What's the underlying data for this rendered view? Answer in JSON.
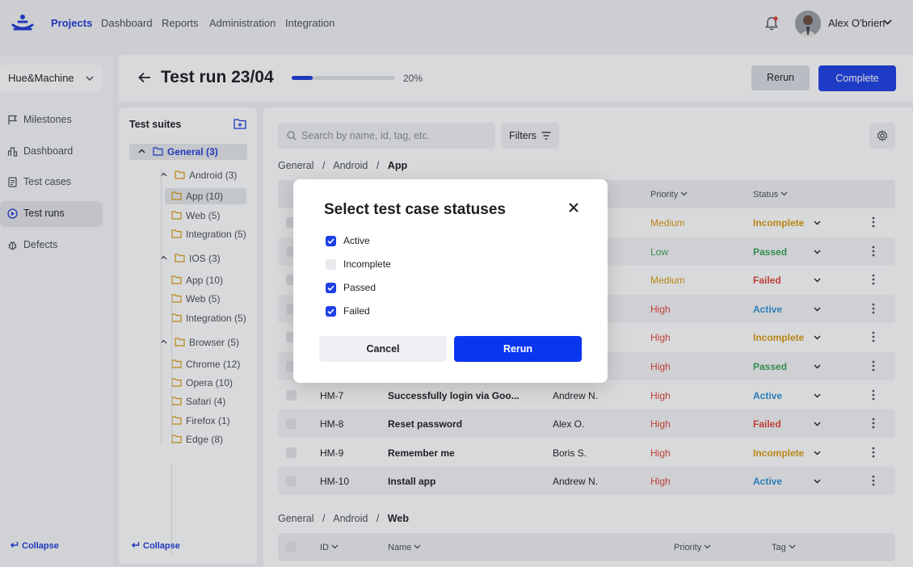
{
  "nav": {
    "links": [
      "Projects",
      "Dashboard",
      "Reports",
      "Administration",
      "Integration"
    ],
    "active": "Projects",
    "user_name": "Alex O'brien"
  },
  "sidebar": {
    "project": "Hue&Machine",
    "items": [
      {
        "label": "Milestones",
        "icon": "flag-icon"
      },
      {
        "label": "Dashboard",
        "icon": "bar-chart-icon"
      },
      {
        "label": "Test cases",
        "icon": "document-icon"
      },
      {
        "label": "Test runs",
        "icon": "play-circle-icon",
        "active": true
      },
      {
        "label": "Defects",
        "icon": "bug-icon"
      }
    ],
    "collapse_label": "Collapse"
  },
  "header": {
    "title": "Test run 23/04",
    "progress": 0.2,
    "progress_text": "20%",
    "rerun_label": "Rerun",
    "complete_label": "Complete"
  },
  "suites": {
    "title": "Test suites",
    "collapse_label": "Collapse",
    "tree": [
      {
        "label": "General (3)",
        "level": 0,
        "expanded": true,
        "selected": true
      },
      {
        "label": "Android (3)",
        "level": 1,
        "expanded": true
      },
      {
        "label": "App (10)",
        "level": 2,
        "selected": true
      },
      {
        "label": "Web (5)",
        "level": 2
      },
      {
        "label": "Integration (5)",
        "level": 2
      },
      {
        "label": "IOS (3)",
        "level": 1,
        "expanded": true
      },
      {
        "label": "App (10)",
        "level": 2
      },
      {
        "label": "Web (5)",
        "level": 2
      },
      {
        "label": "Integration (5)",
        "level": 2
      },
      {
        "label": "Browser (5)",
        "level": 1,
        "expanded": true
      },
      {
        "label": "Chrome (12)",
        "level": 2
      },
      {
        "label": "Opera (10)",
        "level": 2
      },
      {
        "label": "Safari (4)",
        "level": 2
      },
      {
        "label": "Firefox (1)",
        "level": 2
      },
      {
        "label": "Edge (8)",
        "level": 2
      }
    ]
  },
  "toolbar": {
    "search_placeholder": "Search by name, id, tag, etc.",
    "filters_label": "Filters"
  },
  "table1": {
    "breadcrumb": [
      "General",
      "Android",
      "App"
    ],
    "headers": {
      "priority": "Priority",
      "status": "Status"
    },
    "rows": [
      {
        "id": "",
        "name": "",
        "author": "",
        "priority": "Medium",
        "status": "Incomplete"
      },
      {
        "id": "",
        "name": "",
        "author": "",
        "priority": "Low",
        "status": "Passed"
      },
      {
        "id": "",
        "name": "",
        "author": "",
        "priority": "Medium",
        "status": "Failed"
      },
      {
        "id": "",
        "name": "",
        "author": "",
        "priority": "High",
        "status": "Active"
      },
      {
        "id": "",
        "name": "",
        "author": "",
        "priority": "High",
        "status": "Incomplete"
      },
      {
        "id": "",
        "name": "",
        "author": "",
        "priority": "High",
        "status": "Passed"
      },
      {
        "id": "HM-7",
        "name": "Successfully login via Goo...",
        "author": "Andrew N.",
        "priority": "High",
        "status": "Active"
      },
      {
        "id": "HM-8",
        "name": "Reset password",
        "author": "Alex O.",
        "priority": "High",
        "status": "Failed"
      },
      {
        "id": "HM-9",
        "name": "Remember me",
        "author": "Boris S.",
        "priority": "High",
        "status": "Incomplete"
      },
      {
        "id": "HM-10",
        "name": "Install app",
        "author": "Andrew N.",
        "priority": "High",
        "status": "Active"
      }
    ]
  },
  "table2": {
    "breadcrumb": [
      "General",
      "Android",
      "Web"
    ],
    "headers": {
      "id": "ID",
      "name": "Name",
      "priority": "Priority",
      "tag": "Tag"
    }
  },
  "modal": {
    "title": "Select test case statuses",
    "options": [
      {
        "label": "Active",
        "checked": true
      },
      {
        "label": "Incomplete",
        "checked": false
      },
      {
        "label": "Passed",
        "checked": true
      },
      {
        "label": "Failed",
        "checked": true
      }
    ],
    "cancel_label": "Cancel",
    "rerun_label": "Rerun"
  },
  "colors": {
    "accent": "#1d3fe6",
    "high": "#e0443b",
    "medium": "#d99b12",
    "low": "#3aa35a",
    "active": "#2c8fd6"
  }
}
